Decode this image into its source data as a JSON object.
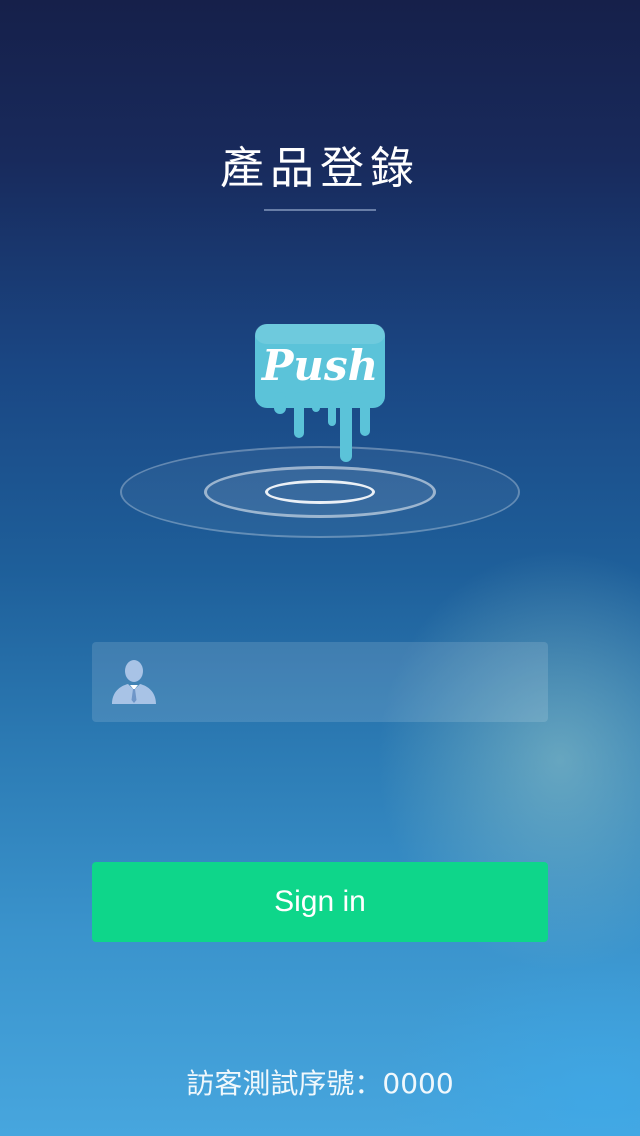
{
  "header": {
    "title": "產品登錄"
  },
  "logo": {
    "text": "Push",
    "color": "#5bc3d9",
    "icon": "push-logo-icon"
  },
  "login": {
    "username_icon": "user-icon",
    "username_value": "",
    "username_placeholder": "",
    "signin_label": "Sign in",
    "signin_color": "#0ed68a"
  },
  "footer": {
    "guest_serial_label": "訪客測試序號：",
    "guest_serial_value": "0000"
  }
}
